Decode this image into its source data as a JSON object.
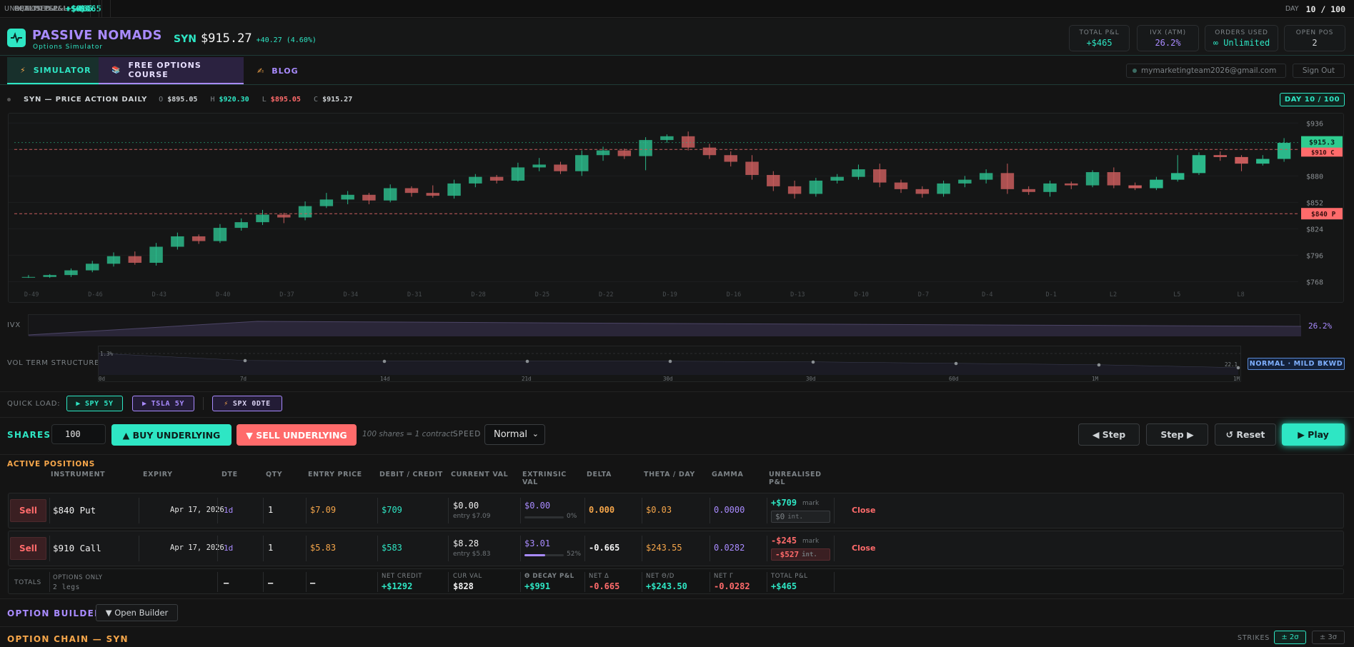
{
  "topbar": {
    "unrealised_label": "UNREALISED P&L",
    "unrealised_value": "+$465",
    "realised_label": "REALISED P&L",
    "realised_value": "+$0",
    "equity_label": "EQUITY P&L",
    "equity_value": "+$0",
    "option_label": "OPTION P&L",
    "option_value": "+$465",
    "day_label": "DAY",
    "day_value": "10 / 100"
  },
  "header": {
    "brand": "PASSIVE NOMADS",
    "brand_sub": "Options Simulator",
    "symbol": "SYN",
    "price": "$915.27",
    "change": "+40.27 (4.60%)",
    "stats": [
      {
        "label": "TOTAL P&L",
        "value": "+$465"
      },
      {
        "label": "IVX (ATM)",
        "value": "26.2%"
      },
      {
        "label": "ORDERS USED",
        "value": "∞ Unlimited"
      },
      {
        "label": "OPEN POS",
        "value": "2"
      }
    ]
  },
  "nav": {
    "tabs": [
      {
        "icon": "⚡",
        "label": "SIMULATOR"
      },
      {
        "icon": "📚",
        "label": "FREE OPTIONS COURSE"
      },
      {
        "icon": "✍",
        "label": "BLOG"
      }
    ],
    "email": "mymarketingteam2026@gmail.com",
    "signout": "Sign Out"
  },
  "chart": {
    "title": "SYN — PRICE ACTION DAILY",
    "o_label": "O",
    "o": "$895.05",
    "h_label": "H",
    "h": "$920.30",
    "l_label": "L",
    "l": "$895.05",
    "c_label": "C",
    "c": "$915.27",
    "day_badge": "DAY 10 / 100",
    "last_price_tag": "$915.3",
    "put_tag": "$840 P",
    "call_tag": "$910 C"
  },
  "chart_data": {
    "type": "candlestick",
    "ylim": [
      760,
      940
    ],
    "yticks": [
      "$936",
      "$908",
      "$880",
      "$852",
      "$824",
      "$796",
      "$768"
    ],
    "ytick_values": [
      936,
      908,
      880,
      852,
      824,
      796,
      768
    ],
    "xticks": [
      "D-49",
      "D-46",
      "D-43",
      "D-40",
      "D-37",
      "D-34",
      "D-31",
      "D-28",
      "D-25",
      "D-22",
      "D-19",
      "D-16",
      "D-13",
      "D-10",
      "D-7",
      "D-4",
      "D-1",
      "L2",
      "L5",
      "L8"
    ],
    "candles": [
      [
        773,
        773,
        775,
        772
      ],
      [
        773,
        775,
        776,
        772
      ],
      [
        775,
        780,
        782,
        773
      ],
      [
        780,
        787,
        790,
        778
      ],
      [
        787,
        795,
        799,
        784
      ],
      [
        795,
        788,
        800,
        786
      ],
      [
        788,
        805,
        809,
        785
      ],
      [
        805,
        816,
        820,
        802
      ],
      [
        816,
        811,
        818,
        808
      ],
      [
        811,
        825,
        829,
        809
      ],
      [
        825,
        831,
        835,
        822
      ],
      [
        831,
        839,
        844,
        828
      ],
      [
        839,
        836,
        841,
        830
      ],
      [
        836,
        848,
        853,
        833
      ],
      [
        848,
        855,
        862,
        846
      ],
      [
        855,
        860,
        864,
        850
      ],
      [
        860,
        854,
        862,
        850
      ],
      [
        854,
        867,
        871,
        852
      ],
      [
        867,
        862,
        869,
        858
      ],
      [
        862,
        859,
        870,
        857
      ],
      [
        859,
        872,
        876,
        856
      ],
      [
        872,
        879,
        882,
        868
      ],
      [
        879,
        875,
        881,
        872
      ],
      [
        875,
        889,
        894,
        874
      ],
      [
        889,
        892,
        899,
        885
      ],
      [
        892,
        885,
        895,
        882
      ],
      [
        885,
        902,
        907,
        880
      ],
      [
        902,
        907,
        911,
        896
      ],
      [
        907,
        901,
        909,
        898
      ],
      [
        901,
        918,
        921,
        886
      ],
      [
        918,
        922,
        924,
        915
      ],
      [
        922,
        910,
        927,
        907
      ],
      [
        910,
        902,
        914,
        898
      ],
      [
        902,
        895,
        906,
        890
      ],
      [
        895,
        881,
        902,
        876
      ],
      [
        881,
        869,
        885,
        864
      ],
      [
        869,
        861,
        875,
        856
      ],
      [
        861,
        875,
        878,
        858
      ],
      [
        875,
        879,
        882,
        872
      ],
      [
        879,
        887,
        892,
        876
      ],
      [
        887,
        873,
        893,
        868
      ],
      [
        873,
        866,
        876,
        862
      ],
      [
        866,
        861,
        869,
        857
      ],
      [
        861,
        872,
        875,
        858
      ],
      [
        872,
        876,
        880,
        868
      ],
      [
        876,
        883,
        887,
        872
      ],
      [
        883,
        866,
        893,
        861
      ],
      [
        866,
        863,
        869,
        860
      ],
      [
        863,
        872,
        875,
        858
      ],
      [
        872,
        870,
        874,
        866
      ],
      [
        870,
        884,
        886,
        868
      ],
      [
        884,
        870,
        889,
        867
      ],
      [
        870,
        867,
        873,
        865
      ],
      [
        867,
        876,
        879,
        865
      ],
      [
        876,
        883,
        902,
        874
      ],
      [
        883,
        902,
        905,
        881
      ],
      [
        902,
        900,
        906,
        896
      ],
      [
        900,
        893,
        902,
        885
      ],
      [
        893,
        898,
        902,
        891
      ],
      [
        898,
        915,
        920,
        895
      ]
    ]
  },
  "ivx": {
    "label": "IVX",
    "value": "26.2%"
  },
  "vts": {
    "label": "VOL TERM STRUCTURE",
    "badge": "NORMAL · MILD BKWD",
    "top_label": "1.3%",
    "end_label": "22.1",
    "xticks": [
      "0d",
      "7d",
      "14d",
      "21d",
      "30d",
      "30d",
      "60d",
      "1M",
      "1M"
    ]
  },
  "quick_load": {
    "label": "QUICK LOAD:",
    "buttons": [
      {
        "icon": "▶",
        "label": "SPY 5Y"
      },
      {
        "icon": "▶",
        "label": "TSLA 5Y"
      },
      {
        "icon": "⚡",
        "label": "SPX 0DTE"
      }
    ]
  },
  "controls": {
    "shares_label": "SHARES",
    "shares_value": "100",
    "buy_label": "▲ BUY UNDERLYING",
    "sell_label": "▼ SELL UNDERLYING",
    "hint": "100 shares = 1 contract",
    "speed_label": "SPEED",
    "speed_value": "Normal",
    "step_back": "◀ Step",
    "step_fwd": "Step ▶",
    "reset": "↺ Reset",
    "play": "▶ Play"
  },
  "positions": {
    "title": "ACTIVE POSITIONS",
    "columns": [
      "INSTRUMENT",
      "EXPIRY",
      "DTE",
      "QTY",
      "ENTRY PRICE",
      "DEBIT / CREDIT",
      "CURRENT VAL",
      "EXTRINSIC",
      "VAL",
      "DELTA",
      "THETA / DAY",
      "GAMMA",
      "UNREALISED",
      "P&L"
    ],
    "rows": [
      {
        "side": "Sell",
        "instrument": "$840 Put",
        "expiry": "Apr 17, 2026",
        "dte": "1d",
        "qty": "1",
        "entry": "$7.09",
        "debit_credit": "$709",
        "current": "$0.00",
        "current_sub": "entry $7.09",
        "extrinsic": "$0.00",
        "extrinsic_pct": "0%",
        "extrinsic_frac": 0.0,
        "delta": "0.000",
        "theta": "$0.03",
        "gamma": "0.0000",
        "unreal": "+$709",
        "unreal_sub": "mark",
        "pnl_box": "$0",
        "pnl_box_sub": "int.",
        "close": "Close"
      },
      {
        "side": "Sell",
        "instrument": "$910 Call",
        "expiry": "Apr 17, 2026",
        "dte": "1d",
        "qty": "1",
        "entry": "$5.83",
        "debit_credit": "$583",
        "current": "$8.28",
        "current_sub": "entry $5.83",
        "extrinsic": "$3.01",
        "extrinsic_pct": "52%",
        "extrinsic_frac": 0.52,
        "delta": "-0.665",
        "theta": "$243.55",
        "gamma": "0.0282",
        "unreal": "-$245",
        "unreal_sub": "mark",
        "pnl_box": "-$527",
        "pnl_box_sub": "int.",
        "close": "Close"
      }
    ],
    "totals": {
      "label": "TOTALS",
      "opt_label": "OPTIONS ONLY",
      "opt_sub": "2 legs",
      "dash": "—",
      "net_credit_label": "NET CREDIT",
      "net_credit": "+$1292",
      "cur_val_label": "CUR VAL",
      "cur_val": "$828",
      "decay_label": "Θ DECAY P&L",
      "decay": "+$991",
      "net_delta_label": "NET Δ",
      "net_delta": "-0.665",
      "net_theta_label": "NET Θ/D",
      "net_theta": "+$243.50",
      "net_gamma_label": "NET Γ",
      "net_gamma": "-0.0282",
      "total_pnl_label": "TOTAL P&L",
      "total_pnl": "+$465"
    }
  },
  "builder": {
    "title": "OPTION BUILDER",
    "button": "▼ Open Builder"
  },
  "chain": {
    "title": "OPTION CHAIN — SYN",
    "strikes_label": "STRIKES",
    "btn1": "± 2σ",
    "btn2": "± 3σ"
  }
}
